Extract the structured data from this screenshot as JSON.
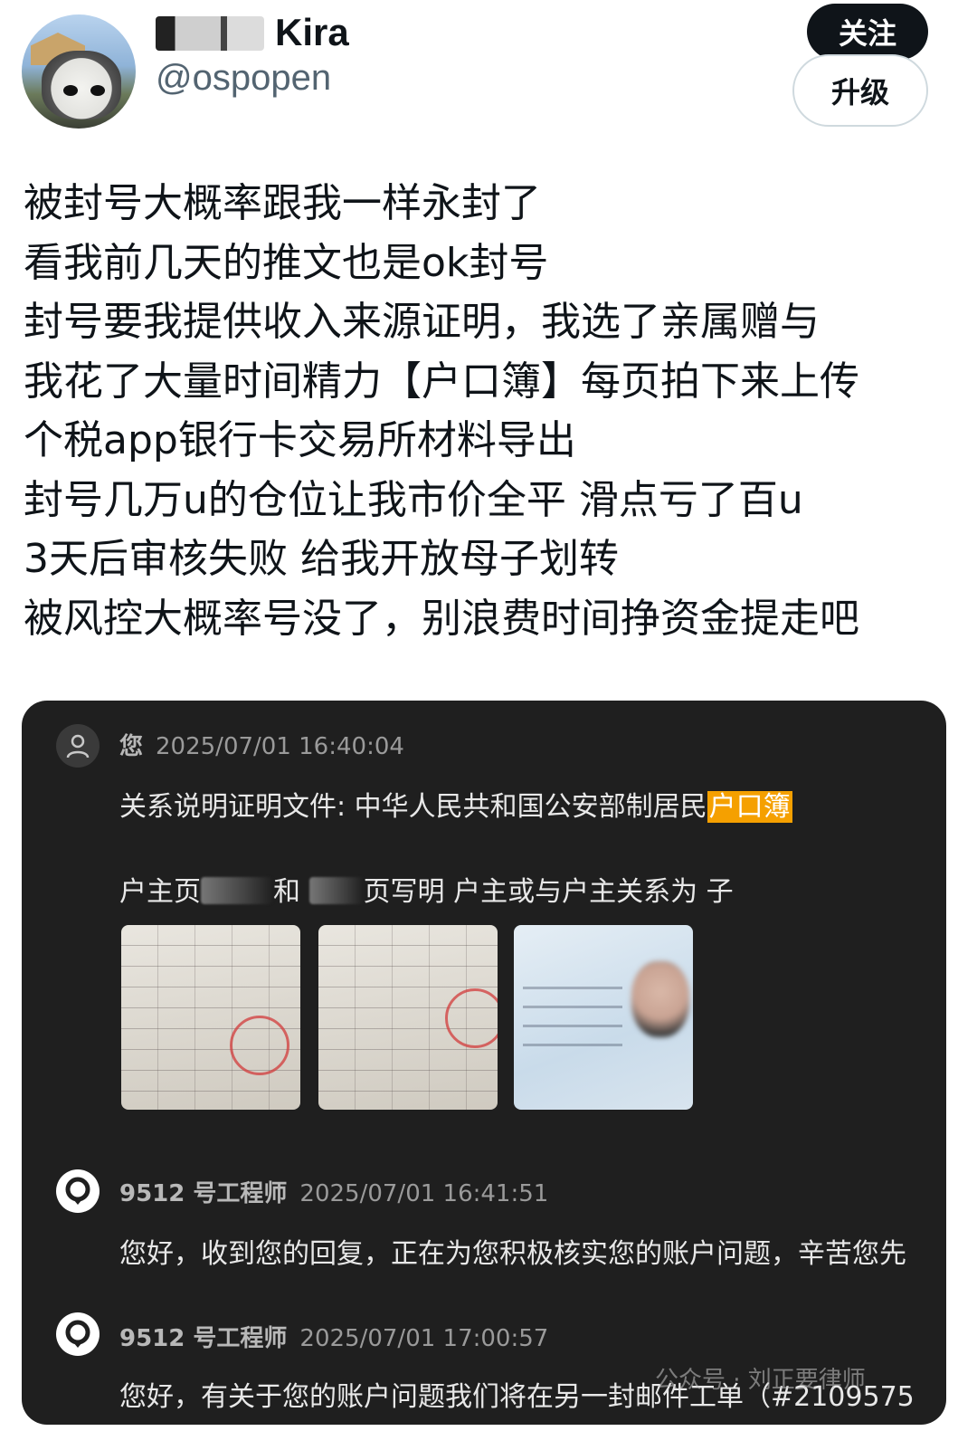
{
  "header": {
    "display_name": "Kira",
    "handle": "@ospopen",
    "follow_label": "关注",
    "upgrade_label": "升级"
  },
  "tweet": {
    "lines": [
      "被封号大概率跟我一样永封了",
      "看我前几天的推文也是ok封号",
      "封号要我提供收入来源证明，我选了亲属赠与",
      "我花了大量时间精力【户口簿】每页拍下来上传",
      "个税app银行卡交易所材料导出",
      "封号几万u的仓位让我市价全平 滑点亏了百u",
      "3天后审核失败 给我开放母子划转",
      "被风控大概率号没了，别浪费时间挣资金提走吧"
    ]
  },
  "media": {
    "messages": [
      {
        "sender": "您",
        "time": "2025/07/01 16:40:04",
        "text_main": "关系说明证明文件: 中华人民共和国公安部制居民",
        "text_highlight": "户口簿",
        "text_2a": "户主页",
        "text_2b": "和",
        "text_2c": "页写明 户主或与户主关系为 子"
      },
      {
        "sender": "9512 号工程师",
        "time": "2025/07/01 16:41:51",
        "text": "您好，收到您的回复，正在为您积极核实您的账户问题，辛苦您先"
      },
      {
        "sender": "9512 号工程师",
        "time": "2025/07/01 17:00:57",
        "text": "您好，有关于您的账户问题我们将在另一封邮件工单（#2109575"
      }
    ],
    "watermark": "公众号 · 刘正要律师"
  },
  "colors": {
    "highlight": "#f5a000",
    "panel_bg": "#1f1f1f"
  }
}
